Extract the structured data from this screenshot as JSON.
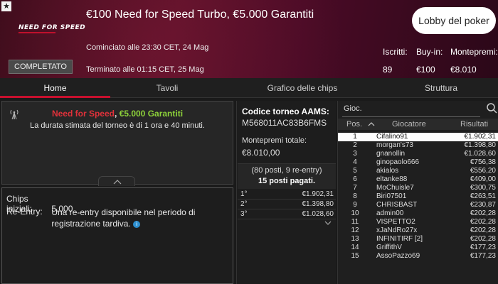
{
  "header": {
    "logo_text": "NEED FOR SPEED",
    "title": "€100 Need for Speed Turbo, €5.000 Garantiti",
    "started": "Cominciato alle 23:30 CET, 24 Mag",
    "ended": "Terminato alle 01:15 CET, 25 Mag",
    "status": "COMPLETATO",
    "lobby_button": "Lobby del poker",
    "stats": [
      {
        "label": "Iscritti:",
        "value": "89"
      },
      {
        "label": "Buy-in:",
        "value": "€100"
      },
      {
        "label": "Montepremi:",
        "value": "€8.010"
      }
    ]
  },
  "tabs": [
    "Home",
    "Tavoli",
    "Grafico delle chips",
    "Struttura"
  ],
  "news": {
    "name_red": "Need for Speed",
    "sep": ", ",
    "name_green": "€5.000 Garantiti",
    "description": "La durata stimata del torneo è di 1 ora e 40 minuti."
  },
  "info": {
    "chips_label": "Chips iniziali:",
    "chips_value": "5.000",
    "reentry_label": "Re-Entry:",
    "reentry_value": "Una re-entry disponibile nel periodo di registrazione tardiva.",
    "info_glyph": "i"
  },
  "middle": {
    "code_label": "Codice torneo AAMS:",
    "code_value": "M568011AC83B6FMS",
    "prize_label": "Montepremi totale:",
    "prize_value": "€8.010,00",
    "seats_line1": "(80 posti, 9 re-entry)",
    "seats_line2": "15 posti pagati.",
    "payouts": [
      {
        "pos": "1°",
        "amount": "€1.902,31"
      },
      {
        "pos": "2°",
        "amount": "€1.398,80"
      },
      {
        "pos": "3°",
        "amount": "€1.028,60"
      }
    ]
  },
  "players": {
    "search_label": "Gioc.",
    "headers": {
      "pos": "Pos.",
      "player": "Giocatore",
      "result": "Risultati"
    },
    "rows": [
      {
        "pos": "1",
        "name": "Cifalino91",
        "result": "€1.902,31"
      },
      {
        "pos": "2",
        "name": "morgan's73",
        "result": "€1.398,80"
      },
      {
        "pos": "3",
        "name": "gnanollin",
        "result": "€1.028,60"
      },
      {
        "pos": "4",
        "name": "ginopaolo666",
        "result": "€756,38"
      },
      {
        "pos": "5",
        "name": "akialos",
        "result": "€556,20"
      },
      {
        "pos": "6",
        "name": "eltanke88",
        "result": "€409,00"
      },
      {
        "pos": "7",
        "name": "MoChuisle7",
        "result": "€300,75"
      },
      {
        "pos": "8",
        "name": "Biri07501",
        "result": "€263,51"
      },
      {
        "pos": "9",
        "name": "CHRISBAST",
        "result": "€230,87"
      },
      {
        "pos": "10",
        "name": "admin00",
        "result": "€202,28"
      },
      {
        "pos": "11",
        "name": "VISPETTO2",
        "result": "€202,28"
      },
      {
        "pos": "12",
        "name": "xJaNdRo27x",
        "result": "€202,28"
      },
      {
        "pos": "13",
        "name": "INFINITIRF [2]",
        "result": "€202,28"
      },
      {
        "pos": "14",
        "name": "GriffithV",
        "result": "€177,23"
      },
      {
        "pos": "15",
        "name": "AssoPazzo69",
        "result": "€177,23"
      }
    ]
  }
}
